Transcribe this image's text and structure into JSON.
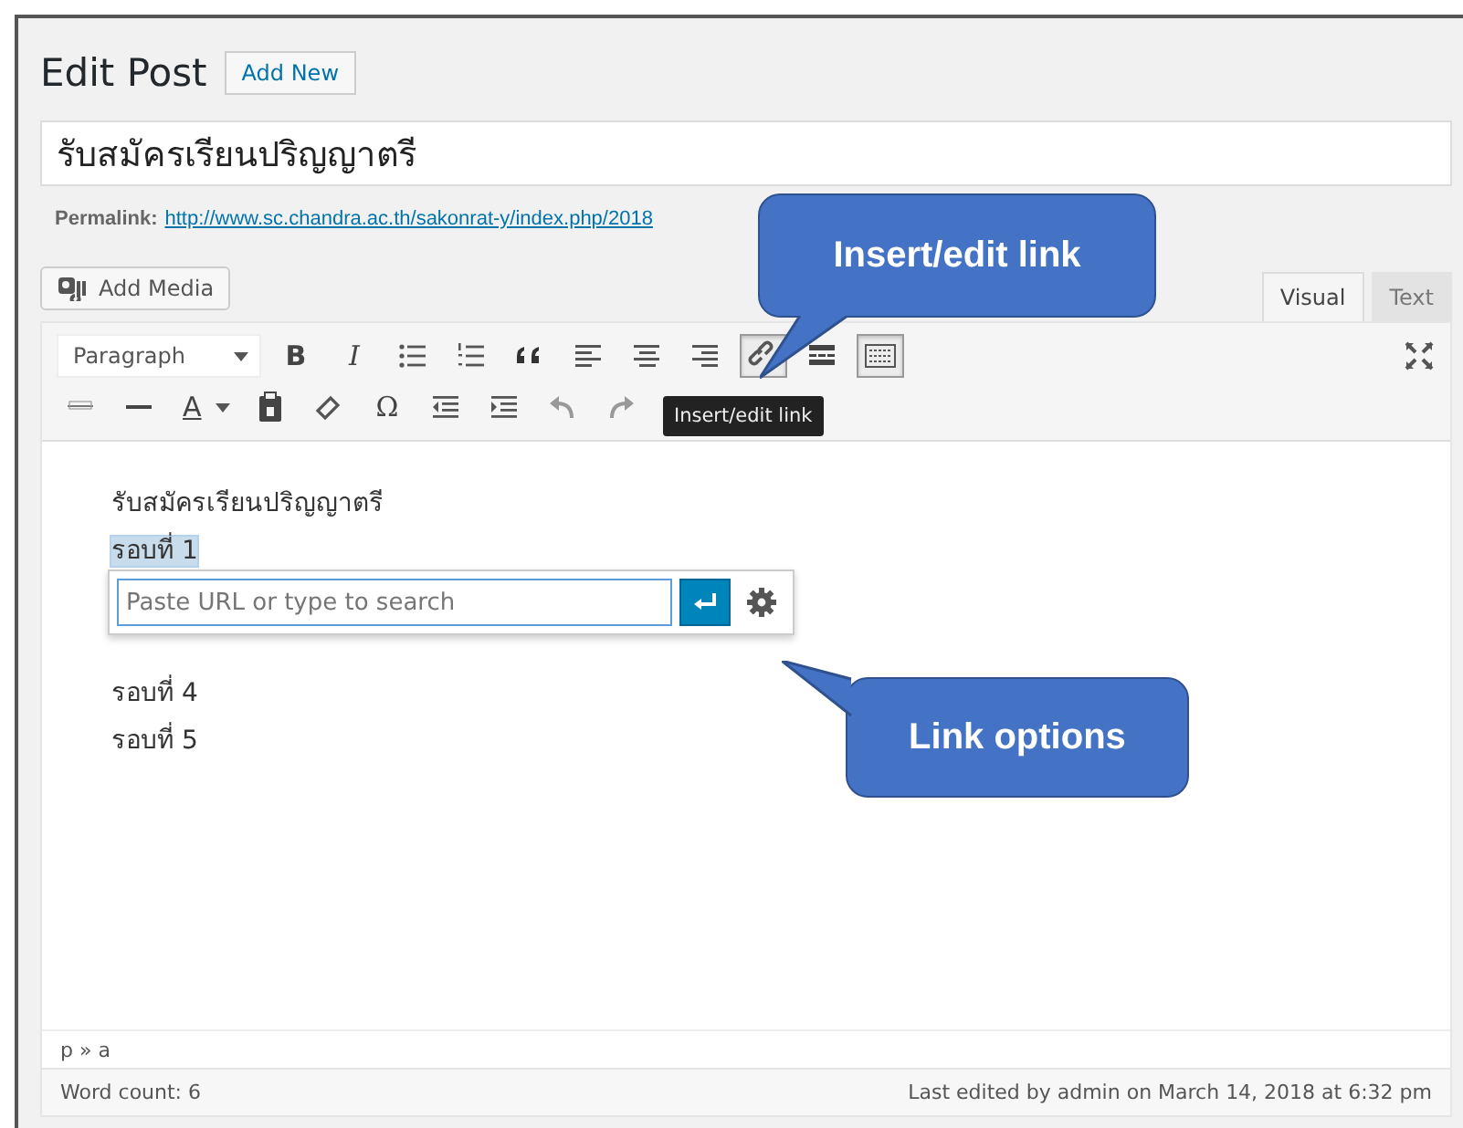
{
  "header": {
    "title": "Edit Post",
    "add_new": "Add New"
  },
  "post_title": "รับสมัครเรียนปริญญาตรี",
  "permalink": {
    "label": "Permalink:",
    "url": "http://www.sc.chandra.ac.th/sakonrat-y/index.php/2018"
  },
  "add_media": "Add Media",
  "editor_tabs": [
    {
      "label": "Visual",
      "selected": true
    },
    {
      "label": "Text",
      "selected": false
    }
  ],
  "toolbar": {
    "format": "Paragraph",
    "row_1": [
      {
        "kind": "bold",
        "text": "B",
        "active": false
      },
      {
        "kind": "italic",
        "text": "I",
        "active": false
      },
      {
        "kind": "bullet-list",
        "active": false
      },
      {
        "kind": "number-list",
        "active": false
      },
      {
        "kind": "quote",
        "active": false
      },
      {
        "kind": "align-left",
        "active": false
      },
      {
        "kind": "align-center",
        "active": false
      },
      {
        "kind": "align-right",
        "active": false
      },
      {
        "kind": "link",
        "active": true
      },
      {
        "kind": "read-more",
        "active": false
      },
      {
        "kind": "toolbar-toggle",
        "active": true
      }
    ],
    "row_2": [
      {
        "kind": "strike",
        "active": false
      },
      {
        "kind": "hr",
        "active": false
      },
      {
        "kind": "text-color",
        "text": "A",
        "active": false
      },
      {
        "kind": "paste",
        "active": false
      },
      {
        "kind": "eraser",
        "active": false
      },
      {
        "kind": "symbol",
        "text": "Ω",
        "active": false
      },
      {
        "kind": "outdent",
        "active": false
      },
      {
        "kind": "indent",
        "active": false
      },
      {
        "kind": "undo",
        "active": false
      },
      {
        "kind": "redo",
        "active": false
      }
    ]
  },
  "tooltip": "Insert/edit link",
  "content": [
    {
      "text": "รับสมัครเรียนปริญญาตรี",
      "selected": false
    },
    {
      "text": "รอบที่ 1",
      "selected": true
    },
    {
      "text": "รอบที่ 4",
      "selected": false
    },
    {
      "text": "รอบที่ 5",
      "selected": false
    }
  ],
  "link_popup": {
    "placeholder": "Paste URL or type to search"
  },
  "path": "p » a",
  "word_count": "Word count: 6",
  "last_edited": "Last edited by admin on March 14, 2018 at 6:32 pm",
  "callouts": [
    {
      "text": "Insert/edit link",
      "kind": "tail-down-left"
    },
    {
      "text": "Link options",
      "kind": "tail-up-left"
    }
  ]
}
